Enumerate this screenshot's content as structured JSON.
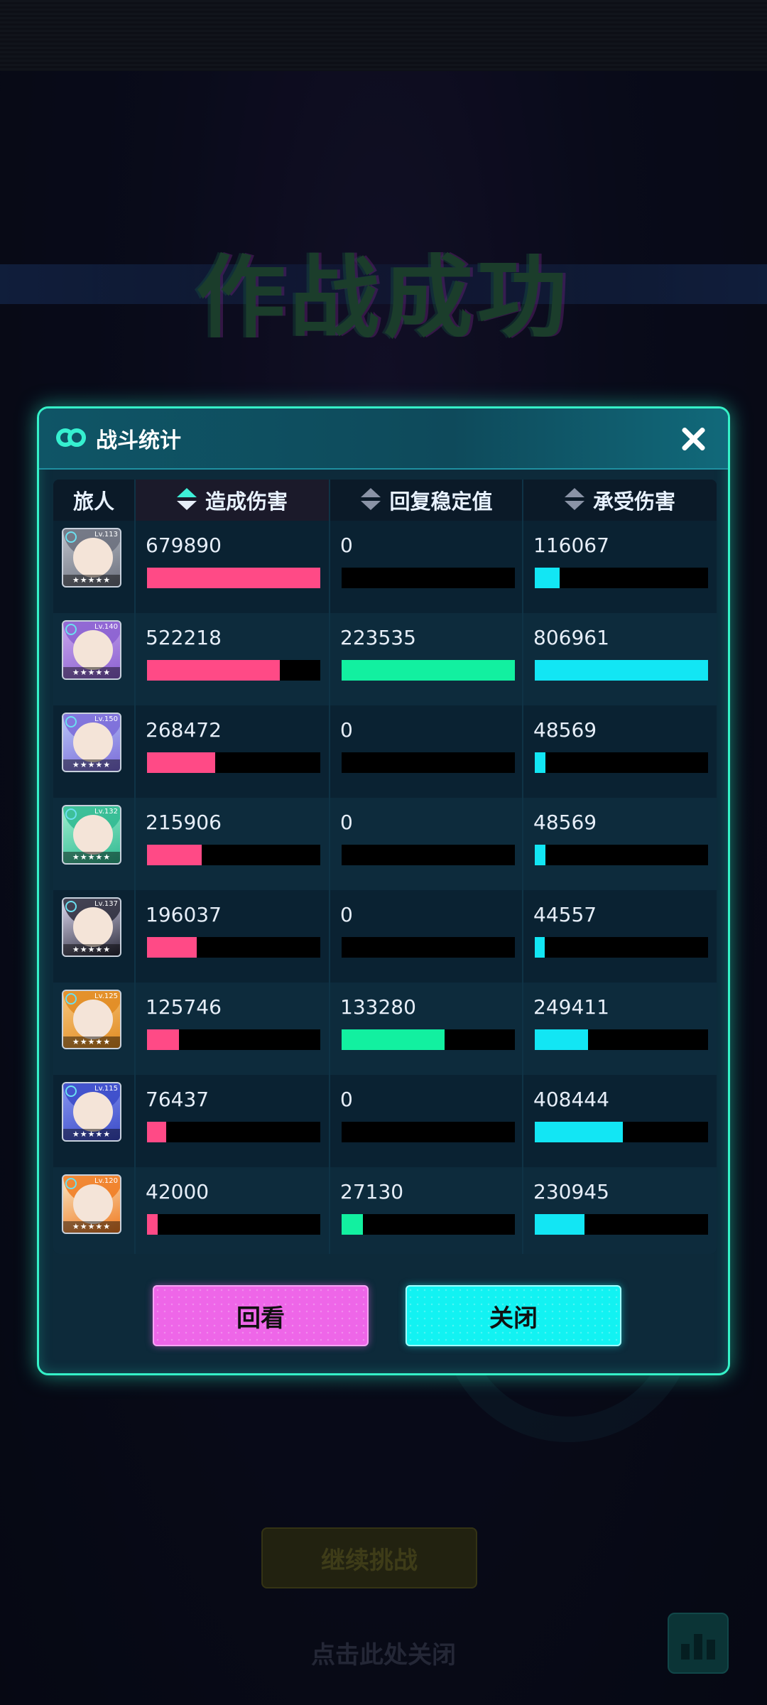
{
  "background": {
    "success_title": "作战成功",
    "continue_label": "继续挑战",
    "close_hint": "点击此处关闭"
  },
  "dialog": {
    "title": "战斗统计",
    "columns": {
      "traveler": "旅人",
      "damage_dealt": "造成伤害",
      "recovery": "回复稳定值",
      "damage_taken": "承受伤害"
    },
    "rows": [
      {
        "level": "Lv.113",
        "damage_dealt": "679890",
        "recovery": "0",
        "damage_taken": "116067",
        "avatar_palette": [
          "#bfc3cc",
          "#6a6f7c"
        ]
      },
      {
        "level": "Lv.140",
        "damage_dealt": "522218",
        "recovery": "223535",
        "damage_taken": "806961",
        "avatar_palette": [
          "#c9a8ee",
          "#8a5fd0"
        ]
      },
      {
        "level": "Lv.150",
        "damage_dealt": "268472",
        "recovery": "0",
        "damage_taken": "48569",
        "avatar_palette": [
          "#b8c8f8",
          "#7a6ad8"
        ]
      },
      {
        "level": "Lv.132",
        "damage_dealt": "215906",
        "recovery": "0",
        "damage_taken": "48569",
        "avatar_palette": [
          "#9ff0d0",
          "#2fb890"
        ]
      },
      {
        "level": "Lv.137",
        "damage_dealt": "196037",
        "recovery": "0",
        "damage_taken": "44557",
        "avatar_palette": [
          "#e0dcf4",
          "#2a2a3a"
        ]
      },
      {
        "level": "Lv.125",
        "damage_dealt": "125746",
        "recovery": "133280",
        "damage_taken": "249411",
        "avatar_palette": [
          "#f8c880",
          "#e08a20"
        ]
      },
      {
        "level": "Lv.115",
        "damage_dealt": "76437",
        "recovery": "0",
        "damage_taken": "408444",
        "avatar_palette": [
          "#8898f0",
          "#3a4ac8"
        ]
      },
      {
        "level": "Lv.120",
        "damage_dealt": "42000",
        "recovery": "27130",
        "damage_taken": "230945",
        "avatar_palette": [
          "#f8e8c8",
          "#f07a20"
        ]
      }
    ],
    "bar_colors": {
      "damage_dealt": "#ff4a86",
      "recovery": "#12f0a0",
      "damage_taken": "#12e6f4"
    },
    "stars_label": "★★★★★",
    "buttons": {
      "replay": "回看",
      "close": "关闭"
    }
  }
}
